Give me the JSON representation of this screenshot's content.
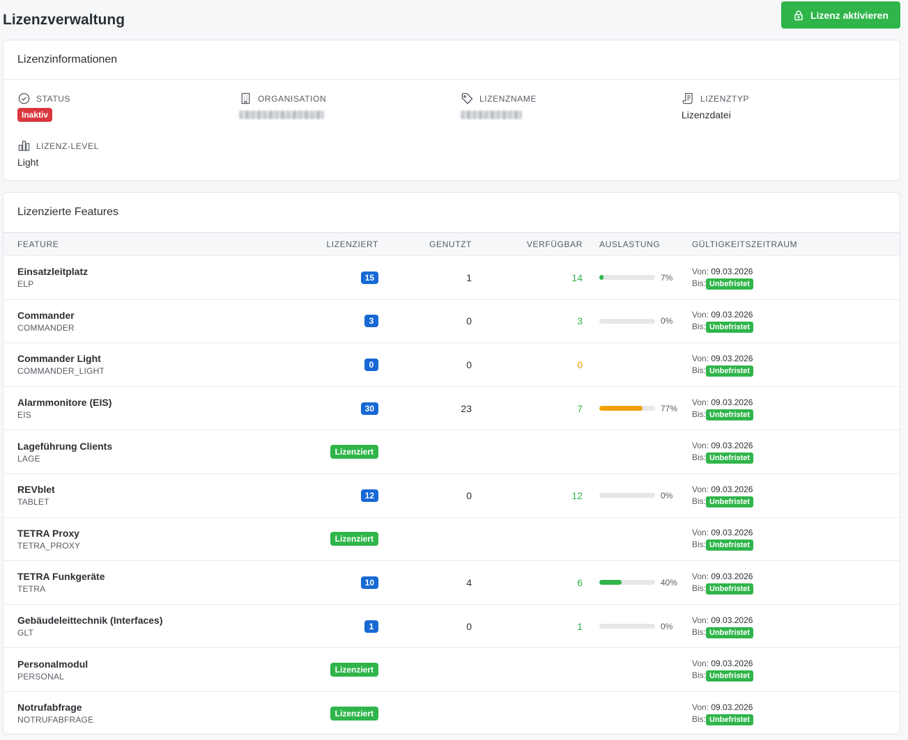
{
  "page": {
    "title": "Lizenzverwaltung",
    "activate_button": "Lizenz aktivieren"
  },
  "info": {
    "title": "Lizenzinformationen",
    "status_label": "STATUS",
    "status_value": "Inaktiv",
    "organisation_label": "ORGANISATION",
    "lizenzname_label": "LIZENZNAME",
    "lizenztyp_label": "LIZENZTYP",
    "lizenztyp_value": "Lizenzdatei",
    "level_label": "LIZENZ-LEVEL",
    "level_value": "Light"
  },
  "features": {
    "title": "Lizenzierte Features",
    "columns": [
      "FEATURE",
      "LIZENZIERT",
      "GENUTZT",
      "VERFÜGBAR",
      "AUSLASTUNG",
      "GÜLTIGKEITSZEITRAUM"
    ],
    "von_label": "Von:",
    "bis_label": "Bis:",
    "rows": [
      {
        "name": "Einsatzleitplatz",
        "code": "ELP",
        "licensed": "15",
        "used": "1",
        "available": "14",
        "avail_color": "green",
        "utilization": 7,
        "util_label": "7%",
        "util_color": "#2fb54a",
        "von": "09.03.2026",
        "bis": "Unbefristet"
      },
      {
        "name": "Commander",
        "code": "COMMANDER",
        "licensed": "3",
        "used": "0",
        "available": "3",
        "avail_color": "green",
        "utilization": 0,
        "util_label": "0%",
        "util_color": "#2fb54a",
        "von": "09.03.2026",
        "bis": "Unbefristet"
      },
      {
        "name": "Commander Light",
        "code": "COMMANDER_LIGHT",
        "licensed": "0",
        "used": "0",
        "available": "0",
        "avail_color": "orange",
        "utilization": null,
        "util_label": "",
        "util_color": "",
        "von": "09.03.2026",
        "bis": "Unbefristet"
      },
      {
        "name": "Alarmmonitore (EIS)",
        "code": "EIS",
        "licensed": "30",
        "used": "23",
        "available": "7",
        "avail_color": "green",
        "utilization": 77,
        "util_label": "77%",
        "util_color": "#f0a000",
        "von": "09.03.2026",
        "bis": "Unbefristet"
      },
      {
        "name": "Lageführung Clients",
        "code": "LAGE",
        "licensed": "Lizenziert",
        "used": "",
        "available": "",
        "avail_color": "green",
        "utilization": null,
        "util_label": "",
        "util_color": "",
        "von": "09.03.2026",
        "bis": "Unbefristet"
      },
      {
        "name": "REVblet",
        "code": "TABLET",
        "licensed": "12",
        "used": "0",
        "available": "12",
        "avail_color": "green",
        "utilization": 0,
        "util_label": "0%",
        "util_color": "#2fb54a",
        "von": "09.03.2026",
        "bis": "Unbefristet"
      },
      {
        "name": "TETRA Proxy",
        "code": "TETRA_PROXY",
        "licensed": "Lizenziert",
        "used": "",
        "available": "",
        "avail_color": "green",
        "utilization": null,
        "util_label": "",
        "util_color": "",
        "von": "09.03.2026",
        "bis": "Unbefristet"
      },
      {
        "name": "TETRA Funkgeräte",
        "code": "TETRA",
        "licensed": "10",
        "used": "4",
        "available": "6",
        "avail_color": "green",
        "utilization": 40,
        "util_label": "40%",
        "util_color": "#2fb54a",
        "von": "09.03.2026",
        "bis": "Unbefristet"
      },
      {
        "name": "Gebäudeleittechnik (Interfaces)",
        "code": "GLT",
        "licensed": "1",
        "used": "0",
        "available": "1",
        "avail_color": "green",
        "utilization": 0,
        "util_label": "0%",
        "util_color": "#2fb54a",
        "von": "09.03.2026",
        "bis": "Unbefristet"
      },
      {
        "name": "Personalmodul",
        "code": "PERSONAL",
        "licensed": "Lizenziert",
        "used": "",
        "available": "",
        "avail_color": "green",
        "utilization": null,
        "util_label": "",
        "util_color": "",
        "von": "09.03.2026",
        "bis": "Unbefristet"
      },
      {
        "name": "Notrufabfrage",
        "code": "NOTRUFABFRAGE",
        "licensed": "Lizenziert",
        "used": "",
        "available": "",
        "avail_color": "green",
        "utilization": null,
        "util_label": "",
        "util_color": "",
        "von": "09.03.2026",
        "bis": "Unbefristet"
      }
    ]
  },
  "icons": {
    "activate": "lock-icon",
    "status": "check-circle-icon",
    "organisation": "building-icon",
    "lizenzname": "tag-icon",
    "lizenztyp": "file-text-icon",
    "level": "bar-chart-icon"
  },
  "colors": {
    "primary_green": "#2fb54a",
    "badge_blue": "#1769d4",
    "danger_red": "#d9363e",
    "warning_orange": "#f0a000"
  }
}
